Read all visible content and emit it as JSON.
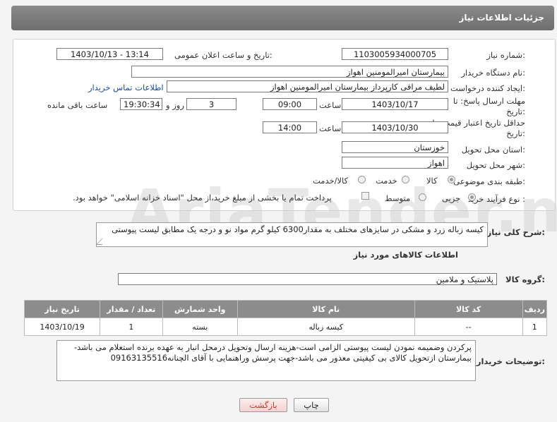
{
  "header": {
    "title": "جزئیات اطلاعات نیاز"
  },
  "fields": {
    "need_number_label": "شماره نیاز:",
    "need_number": "1103005934000705",
    "announce_label": "تاریخ و ساعت اعلان عمومی:",
    "announce_value": "1403/10/13 - 13:14",
    "buyer_org_label": "نام دستگاه خریدار:",
    "buyer_org": "بیمارستان امیرالمومنین اهواز",
    "requester_label": "ایجاد کننده درخواست:",
    "requester": "لطیف مراقی کارپرداز بیمارستان امیرالمومنین اهواز",
    "contact_link": "اطلاعات تماس خریدار",
    "deadline_label_line1": "مهلت ارسال پاسخ: تا",
    "deadline_label_line2": "تاریخ:",
    "deadline_date": "1403/10/17",
    "time_label": "ساعت",
    "deadline_time": "09:00",
    "days_value": "3",
    "days_label": "روز و",
    "remaining_time": "19:30:34",
    "remaining_label": "ساعت باقی مانده",
    "validity_label_line1": "حداقل تاریخ اعتبار قیمت: تا",
    "validity_label_line2": "تاریخ:",
    "validity_date": "1403/10/30",
    "validity_time_label": "ساعت",
    "validity_time": "14:00",
    "province_label": "استان محل تحویل:",
    "province": "خوزستان",
    "city_label": "شهر محل تحویل:",
    "city": "اهواز",
    "category_label": "طبقه بندی موضوعی:",
    "category_options": [
      "کالا",
      "خدمت",
      "کالا/خدمت"
    ],
    "category_selected": 0,
    "process_label": "نوع فرآیند خرید :",
    "process_options": [
      "جزیی",
      "متوسط"
    ],
    "process_selected": 0,
    "payment_note": "پرداخت تمام یا بخشی از مبلغ خرید،از محل \"اسناد خزانه اسلامی\" خواهد بود."
  },
  "description": {
    "label": "شرح کلی نیاز:",
    "text": "کیسه زباله زرد و مشکی در سایزهای مختلف  به مقدار6300 کیلو گرم مواد نو و درجه یک مطابق لیست پیوستی"
  },
  "goods": {
    "section_title": "اطلاعات کالاهای مورد نیاز",
    "group_label": "گروه کالا:",
    "group_value": "پلاستیک و ملامین",
    "columns": [
      "ردیف",
      "کد کالا",
      "نام کالا",
      "واحد شمارش",
      "تعداد / مقدار",
      "تاریخ نیاز"
    ],
    "rows": [
      [
        "1",
        "--",
        "کیسه زباله",
        "بسته",
        "1",
        "1403/10/19"
      ]
    ]
  },
  "buyer_notes": {
    "label": "توضیحات خریدار:",
    "text": "پرکردن وضمیمه نمودن لیست پیوستی الزامی است-هزینه ارسال وتحویل درمحل انبار به عهده برنده استعلام می باشد-بیمارستان ازتحویل کالای بی کیفیتی معذور می باشد-جهت پرسش وراهنمایی با آقای الچنانه09163135516"
  },
  "buttons": {
    "print": "چاپ",
    "back": "بازگشت"
  },
  "watermark": "AriaTender.neT",
  "colors": {
    "header_bg": "#7b7b7b",
    "table_header_bg": "#8c8c8c",
    "link": "#1a4fa0",
    "back_text": "#c0392b"
  }
}
